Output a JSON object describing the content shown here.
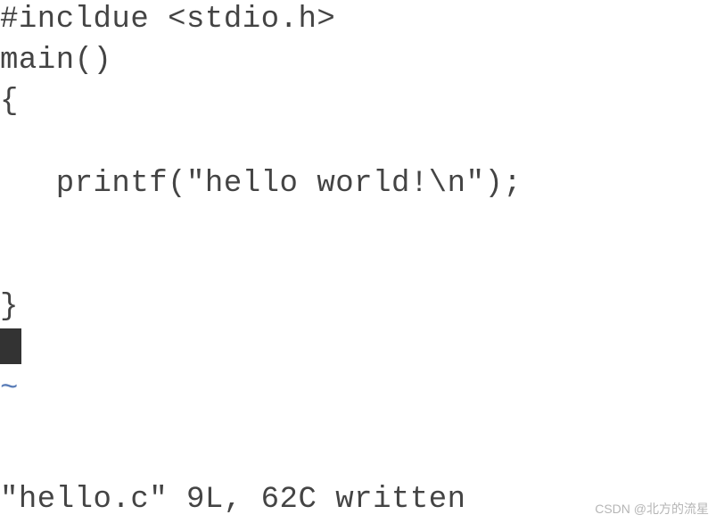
{
  "code": {
    "line1": "#incldue <stdio.h>",
    "line2": "main()",
    "line3": "{",
    "line4": "",
    "line5": "   printf(\"hello world!\\n\");",
    "line6": "",
    "line7": "",
    "line8": "}",
    "tilde": "~"
  },
  "status": "\"hello.c\" 9L, 62C written",
  "watermark": "CSDN @北方的流星"
}
